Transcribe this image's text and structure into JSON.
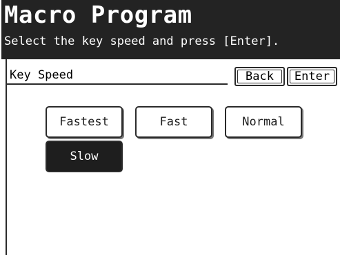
{
  "header": {
    "title": "Macro Program",
    "subtitle": "Select the key speed and press [Enter]."
  },
  "section": {
    "label": "Key Speed"
  },
  "actions": {
    "back_label": "Back",
    "enter_label": "Enter"
  },
  "speed_options": [
    {
      "label": "Fastest",
      "selected": false
    },
    {
      "label": "Fast",
      "selected": false
    },
    {
      "label": "Normal",
      "selected": false
    },
    {
      "label": "Slow",
      "selected": true
    }
  ],
  "colors": {
    "header_bg": "#232323",
    "selected_bg": "#1e1e1e",
    "text": "#1e1e1e"
  }
}
